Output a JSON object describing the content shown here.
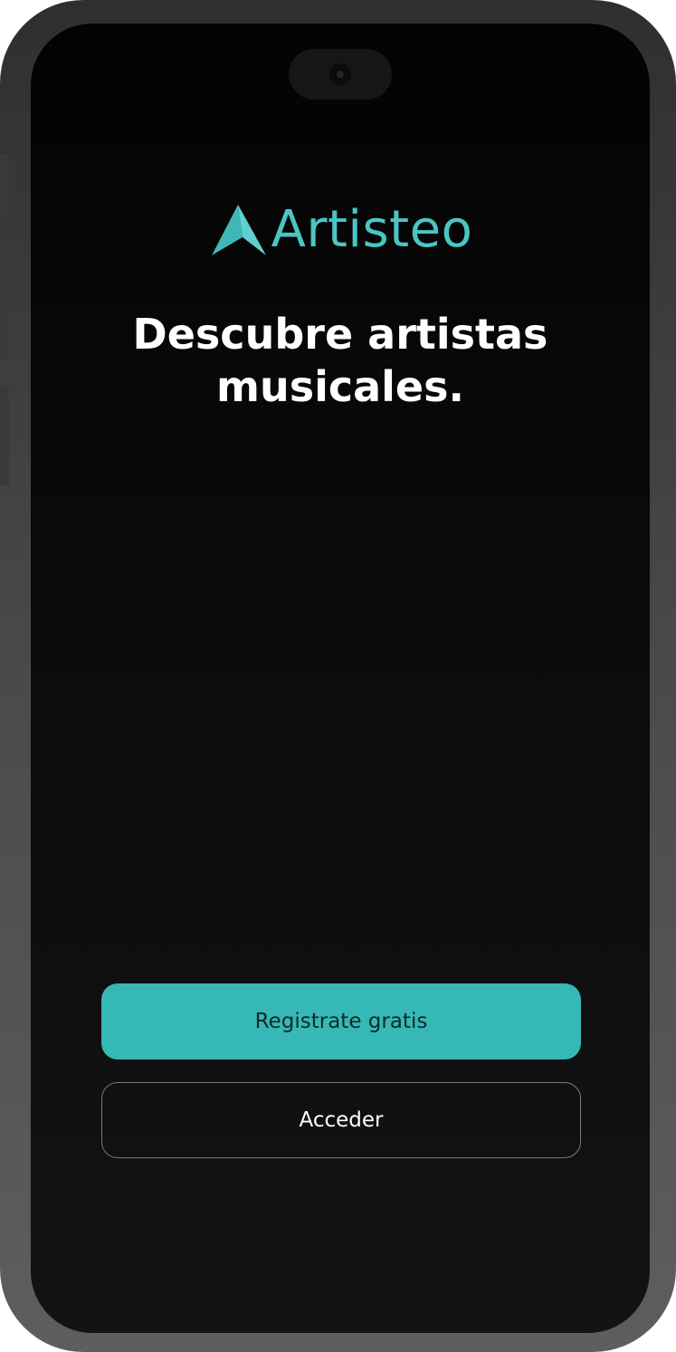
{
  "app": {
    "brand_name": "Artisteo",
    "logo_icon": "paper-plane-arrow-icon",
    "accent_color": "#49c6c4"
  },
  "welcome": {
    "headline": "Descubre artistas musicales."
  },
  "actions": {
    "register_label": "Registrate gratis",
    "register_color": "#35b8b6",
    "login_label": "Acceder"
  }
}
